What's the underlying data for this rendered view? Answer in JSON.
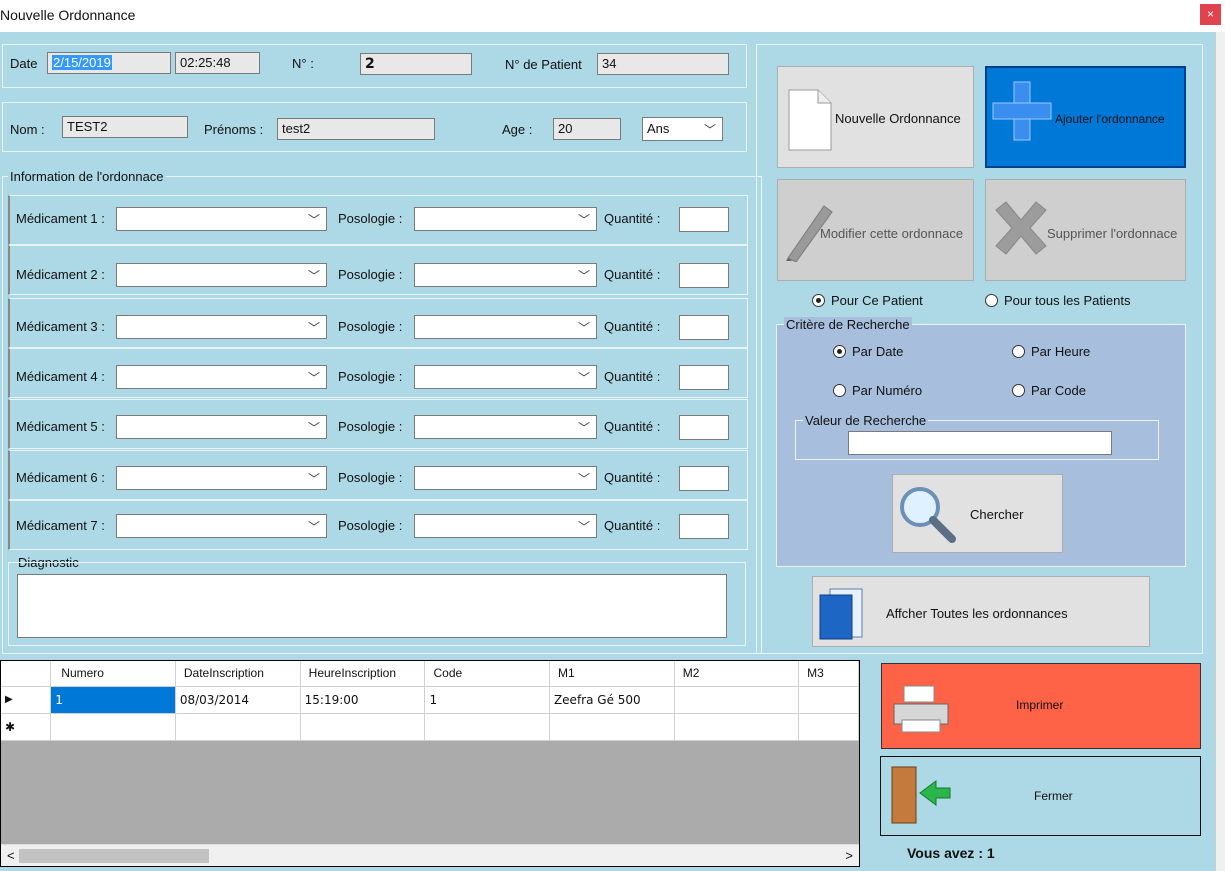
{
  "window": {
    "title": "Nouvelle Ordonnance",
    "close_glyph": "×"
  },
  "header": {
    "date_label": "Date",
    "date_value": "2/15/2019",
    "time_value": "02:25:48",
    "num_label": "N° :",
    "num_value": "2",
    "patient_num_label": "N° de Patient",
    "patient_num_value": "34"
  },
  "patient": {
    "nom_label": "Nom :",
    "nom_value": "TEST2",
    "prenoms_label": "Prénoms :",
    "prenoms_value": "test2",
    "age_label": "Age :",
    "age_value": "20",
    "age_unit": "Ans"
  },
  "ordonnance": {
    "group_label": "Information de l'ordonnace",
    "posologie_label": "Posologie :",
    "quantite_label": "Quantité :",
    "medicaments": [
      {
        "label": "Médicament 1 :"
      },
      {
        "label": "Médicament 2 :"
      },
      {
        "label": "Médicament 3 :"
      },
      {
        "label": "Médicament 4 :"
      },
      {
        "label": "Médicament 5 :"
      },
      {
        "label": "Médicament 6 :"
      },
      {
        "label": "Médicament 7 :"
      }
    ],
    "diagnostic_label": "Diagnostic"
  },
  "actions": {
    "nouvelle": "Nouvelle Ordonnance",
    "ajouter": "Ajouter l'ordonnance",
    "modifier": "Modifier cette ordonnace",
    "supprimer": "Supprimer l'ordonnace",
    "afficher": "Affcher Toutes les ordonnances",
    "chercher": "Chercher",
    "imprimer": "Imprimer",
    "fermer": "Fermer"
  },
  "scope": {
    "pour_ce_patient": "Pour Ce Patient",
    "pour_tous": "Pour tous les Patients",
    "selected": "pour_ce_patient"
  },
  "search": {
    "group_label": "Critère de Recherche",
    "par_date": "Par Date",
    "par_heure": "Par Heure",
    "par_numero": "Par Numéro",
    "par_code": "Par Code",
    "selected": "par_date",
    "valeur_label": "Valeur de Recherche",
    "valeur": ""
  },
  "grid": {
    "columns": [
      "Numero",
      "DateInscription",
      "HeureInscription",
      "Code",
      "M1",
      "M2",
      "M3"
    ],
    "rows": [
      [
        "1",
        "08/03/2014",
        "15:19:00",
        "1",
        "Zeefra Gé 500",
        "",
        ""
      ]
    ],
    "current_marker": "▶",
    "new_marker": "✱"
  },
  "status": {
    "count_text": "Vous avez :  1"
  },
  "colors": {
    "background": "#add8e6",
    "accent_blue": "#0078d7",
    "imprimer_red": "#ff6347",
    "close_red": "#e0424e"
  },
  "icons": {
    "nouvelle": "document-icon",
    "ajouter": "plus-icon",
    "modifier": "pencil-icon",
    "supprimer": "x-icon",
    "chercher": "magnifier-icon",
    "afficher": "folder-icon",
    "imprimer": "printer-icon",
    "fermer": "door-exit-icon"
  }
}
